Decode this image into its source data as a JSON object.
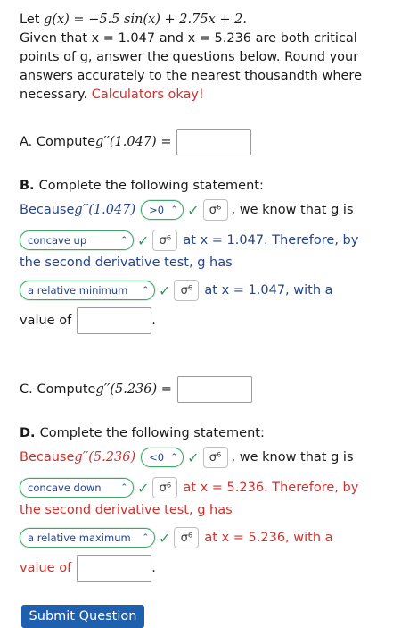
{
  "intro": {
    "line1_prefix": "Let ",
    "func": "g(x) = −5.5 sin(x) + 2.75x + 2.",
    "line2": "Given that x = 1.047 and x = 5.236 are both critical points of g, answer the questions below. Round your answers accurately to the nearest thousandth where necessary.",
    "calc_note": "Calculators okay!"
  },
  "partA": {
    "label": "A.",
    "text": "Compute ",
    "expr": "g′′(1.047) ="
  },
  "partB": {
    "label": "B.",
    "heading": "Complete the following statement:",
    "because": "Because ",
    "expr": "g′′(1.047)",
    "sign_value": ">0",
    "we_know": ", we know that g is",
    "concavity_value": "concave up",
    "at_text": "at x = 1.047. Therefore, by",
    "sdt_text": "the second derivative test, g has",
    "extremum_value": "a relative minimum",
    "at_text2": "at x = 1.047, with a",
    "value_of": "value of",
    "period": "."
  },
  "partC": {
    "label": "C.",
    "text": "Compute ",
    "expr": "g′′(5.236) ="
  },
  "partD": {
    "label": "D.",
    "heading": "Complete the following statement:",
    "because": "Because ",
    "expr": "g′′(5.236)",
    "sign_value": "<0",
    "we_know": ", we know that g is",
    "concavity_value": "concave down",
    "at_text": "at x = 5.236. Therefore, by",
    "sdt_text": "the second derivative test, g has",
    "extremum_value": "a relative maximum",
    "at_text2": "at x = 5.236, with a",
    "value_of": "value of",
    "period": "."
  },
  "check_glyph": "✓",
  "sig_glyph": "σ⁶",
  "chevron_glyph": "⌃⌄",
  "submit_label": "Submit Question",
  "colors": {
    "red": "#d0312d",
    "blue": "#24448f",
    "green": "#3ea66b",
    "submit_bg": "#1e5fae"
  }
}
